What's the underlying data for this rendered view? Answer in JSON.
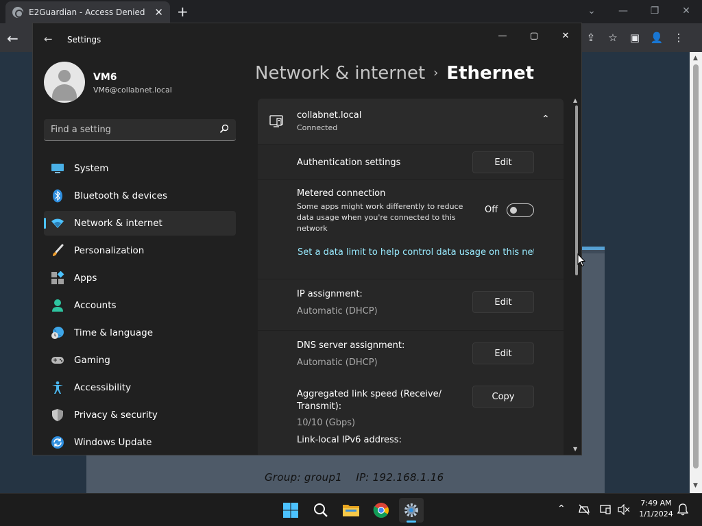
{
  "browser": {
    "tab_title": "E2Guardian - Access Denied",
    "tab_close": "✕",
    "new_tab": "+",
    "window_controls": [
      "⌄",
      "—",
      "❐",
      "✕"
    ],
    "back": "←",
    "toolbar_icons": [
      "⇪",
      "☆",
      "▣",
      "👤",
      "⋮"
    ],
    "page_footer": "Group: group1    IP: 192.168.1.16"
  },
  "settings": {
    "app_title": "Settings",
    "back": "←",
    "window_controls": {
      "minimize": "—",
      "maximize": "▢",
      "close": "✕"
    },
    "profile": {
      "name": "VM6",
      "email": "VM6@collabnet.local"
    },
    "search": {
      "placeholder": "Find a setting",
      "value": ""
    },
    "nav": [
      {
        "label": "System",
        "icon": "system-icon",
        "selected": false
      },
      {
        "label": "Bluetooth & devices",
        "icon": "bluetooth-icon",
        "selected": false
      },
      {
        "label": "Network & internet",
        "icon": "wifi-icon",
        "selected": true
      },
      {
        "label": "Personalization",
        "icon": "brush-icon",
        "selected": false
      },
      {
        "label": "Apps",
        "icon": "apps-icon",
        "selected": false
      },
      {
        "label": "Accounts",
        "icon": "person-icon",
        "selected": false
      },
      {
        "label": "Time & language",
        "icon": "globe-clock-icon",
        "selected": false
      },
      {
        "label": "Gaming",
        "icon": "gamepad-icon",
        "selected": false
      },
      {
        "label": "Accessibility",
        "icon": "accessibility-icon",
        "selected": false
      },
      {
        "label": "Privacy & security",
        "icon": "shield-icon",
        "selected": false
      },
      {
        "label": "Windows Update",
        "icon": "update-icon",
        "selected": false
      }
    ],
    "breadcrumb": {
      "parent": "Network & internet",
      "separator": "›",
      "current": "Ethernet"
    },
    "network": {
      "name": "collabnet.local",
      "status": "Connected",
      "collapse": "⌃",
      "authentication": {
        "label": "Authentication settings",
        "button": "Edit"
      },
      "metered": {
        "label": "Metered connection",
        "description": "Some apps might work differently to reduce data usage when you're connected to this network",
        "toggle_label": "Off",
        "toggle_on": false
      },
      "data_limit_link": "Set a data limit to help control data usage on this network",
      "ip_assignment": {
        "label": "IP assignment:",
        "value": "Automatic (DHCP)",
        "button": "Edit"
      },
      "dns_assignment": {
        "label": "DNS server assignment:",
        "value": "Automatic (DHCP)",
        "button": "Edit"
      },
      "link_speed": {
        "label": "Aggregated link speed (Receive/ Transmit):",
        "value": "10/10 (Gbps)",
        "button": "Copy"
      },
      "ipv6": {
        "label": "Link-local IPv6 address:"
      }
    }
  },
  "taskbar": {
    "tray": {
      "chevron": "⌃"
    },
    "time": "7:49 AM",
    "date": "1/1/2024"
  },
  "colors": {
    "accent": "#4cc2ff",
    "link": "#99ebff",
    "window_bg": "#202020",
    "card_bg": "#272727"
  }
}
